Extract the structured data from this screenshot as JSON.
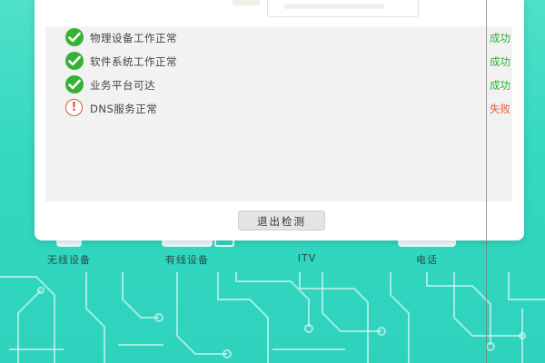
{
  "checks": {
    "items": [
      {
        "label": "物理设备工作正常",
        "result": "成功",
        "status": "ok",
        "icon": "check-circle-icon"
      },
      {
        "label": "软件系统工作正常",
        "result": "成功",
        "status": "ok",
        "icon": "check-circle-icon"
      },
      {
        "label": "业务平台可达",
        "result": "成功",
        "status": "ok",
        "icon": "check-circle-icon"
      },
      {
        "label": "DNS服务正常",
        "result": "失败",
        "status": "fail",
        "icon": "alert-circle-icon",
        "icon_glyph": "!"
      }
    ]
  },
  "actions": {
    "exit_label": "退出检测"
  },
  "devices": {
    "wireless": "无线设备",
    "wired": "有线设备",
    "itv": "ITV",
    "phone": "电话"
  },
  "colors": {
    "success": "#2fb12f",
    "failure": "#e25a3f",
    "background": "#33d8c0"
  }
}
